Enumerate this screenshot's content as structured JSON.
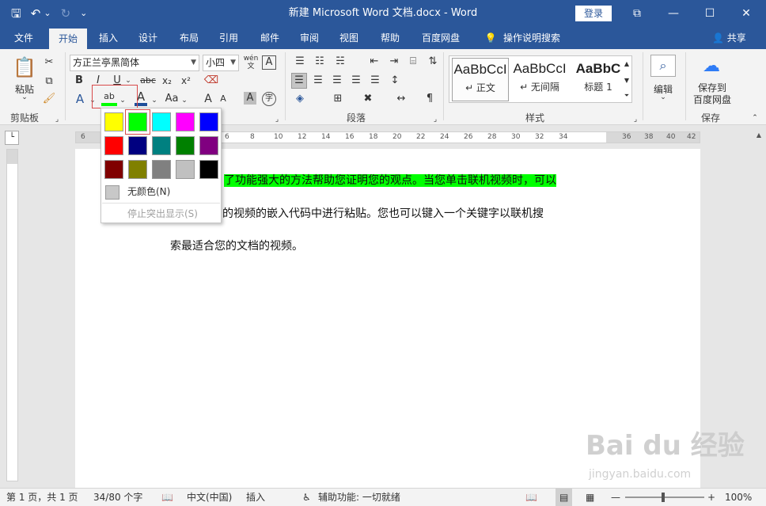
{
  "titlebar": {
    "title": "新建 Microsoft Word 文档.docx  -  Word",
    "login": "登录",
    "qat": {
      "save": "🖫",
      "undo": "↶",
      "undo_dd": "⌄",
      "redo": "↻",
      "customize": "⌄"
    },
    "controls": {
      "ribbon_display": "⧉",
      "minimize": "—",
      "maximize": "☐",
      "close": "✕"
    }
  },
  "tabs": [
    {
      "label": "文件"
    },
    {
      "label": "开始"
    },
    {
      "label": "插入"
    },
    {
      "label": "设计"
    },
    {
      "label": "布局"
    },
    {
      "label": "引用"
    },
    {
      "label": "邮件"
    },
    {
      "label": "审阅"
    },
    {
      "label": "视图"
    },
    {
      "label": "帮助"
    },
    {
      "label": "百度网盘"
    },
    {
      "label": "操作说明搜索"
    }
  ],
  "share": "共享",
  "ribbon": {
    "clipboard": {
      "paste": "粘贴",
      "label": "剪贴板"
    },
    "font": {
      "name": "方正兰亭黑简体",
      "size": "小四",
      "wen": "wén",
      "a_box": "A",
      "bold": "B",
      "italic": "I",
      "underline": "U",
      "strike": "abc",
      "sub": "x₂",
      "sup": "x²",
      "grow": "A",
      "case": "Aa"
    },
    "paragraph": {
      "label": "段落"
    },
    "styles": {
      "label": "样式",
      "items": [
        {
          "sample": "AaBbCcI",
          "name": "↵ 正文"
        },
        {
          "sample": "AaBbCcI",
          "name": "↵ 无间隔"
        },
        {
          "sample": "AaBbC",
          "name": "标题 1"
        }
      ]
    },
    "editing": {
      "label": "编辑"
    },
    "save": {
      "line1": "保存到",
      "line2": "百度网盘",
      "label": "保存"
    }
  },
  "ruler": {
    "numbers": [
      "6",
      "4",
      "2",
      "2",
      "4",
      "6",
      "8",
      "10",
      "12",
      "14",
      "16",
      "18",
      "20",
      "22",
      "24",
      "26",
      "28",
      "30",
      "32",
      "34",
      "36",
      "38",
      "40",
      "42"
    ]
  },
  "document": {
    "line1": "了功能强大的方法帮助您证明您的观点。当您单击联机视频时，可以",
    "line2": "加的视频的嵌入代码中进行粘贴。您也可以键入一个关键字以联机搜",
    "line3": "索最适合您的文档的视频。"
  },
  "highlight_menu": {
    "colors": [
      "#ffff00",
      "#00ff00",
      "#00ffff",
      "#ff00ff",
      "#0000ff",
      "#ff0000",
      "#000080",
      "#008080",
      "#008000",
      "#800080",
      "#800000",
      "#808000",
      "#808080",
      "#c0c0c0",
      "#000000"
    ],
    "selected_index": 1,
    "no_color": "无颜色(N)",
    "stop": "停止突出显示(S)"
  },
  "status": {
    "page": "第 1 页，共 1 页",
    "words": "34/80 个字",
    "lang": "中文(中国)",
    "mode": "插入",
    "accessibility": "辅助功能: 一切就绪",
    "zoom": "100%"
  },
  "watermark": {
    "logo": "Bai du 经验",
    "url": "jingyan.baidu.com"
  }
}
